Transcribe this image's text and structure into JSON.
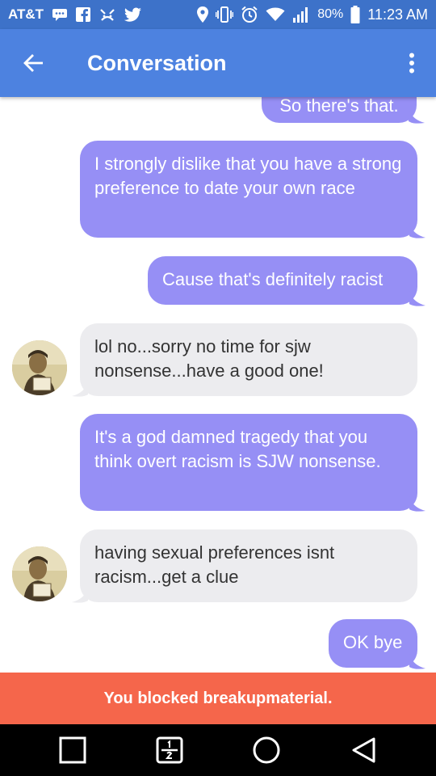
{
  "status_bar": {
    "carrier": "AT&T",
    "battery_percent": "80%",
    "time": "11:23 AM",
    "icons_left": [
      "message-icon",
      "facebook-icon",
      "notification-icon",
      "twitter-icon"
    ],
    "icons_right": [
      "location-icon",
      "vibrate-icon",
      "alarm-icon",
      "wifi-icon",
      "signal-icon",
      "battery-icon"
    ]
  },
  "app_bar": {
    "title": "Conversation",
    "color": "#4d82e0"
  },
  "messages": [
    {
      "direction": "outgoing",
      "text": "So there's that."
    },
    {
      "direction": "outgoing",
      "text": "I strongly dislike that you have a strong preference to date your own race"
    },
    {
      "direction": "outgoing",
      "text": "Cause that's definitely racist"
    },
    {
      "direction": "incoming",
      "text": "lol no...sorry no time for sjw nonsense...have a good one!"
    },
    {
      "direction": "outgoing",
      "text": "It's a god damned tragedy that you think overt racism is SJW nonsense."
    },
    {
      "direction": "incoming",
      "text": "having sexual preferences isnt racism...get a clue"
    },
    {
      "direction": "outgoing",
      "text": "OK bye"
    }
  ],
  "blocked_banner": {
    "text": "You blocked breakupmaterial.",
    "color": "#f5664b"
  },
  "nav_bar": {
    "buttons": [
      "recents-button",
      "dual-window-button",
      "home-button",
      "back-button"
    ]
  },
  "colors": {
    "outgoing_bubble": "#968ff5",
    "incoming_bubble": "#ececef"
  }
}
